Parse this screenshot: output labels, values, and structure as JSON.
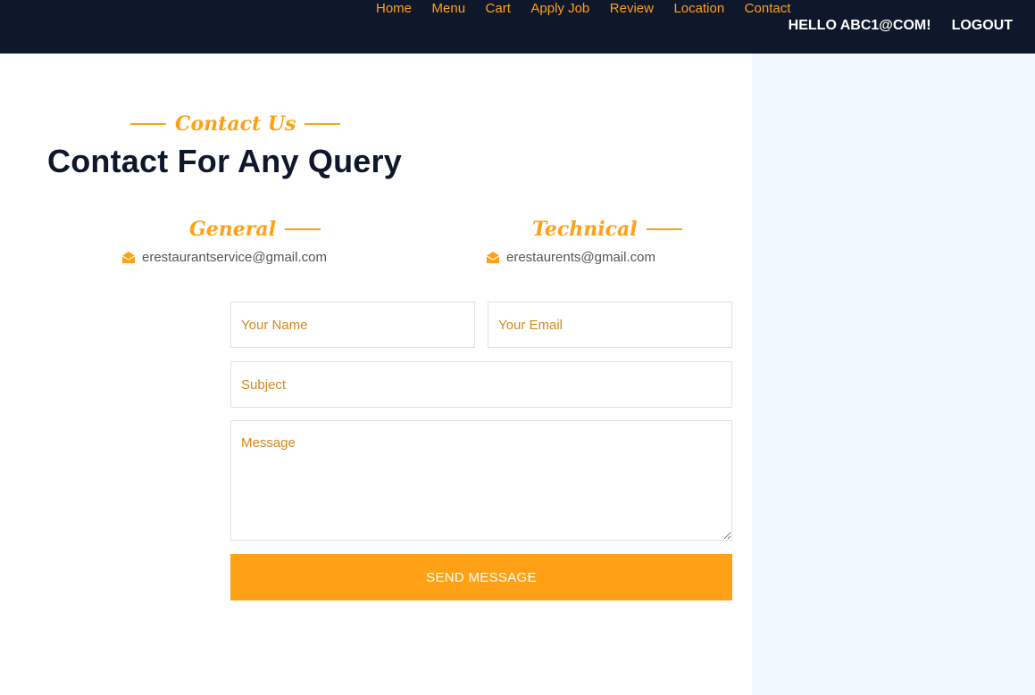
{
  "nav": {
    "links": [
      "Home",
      "Menu",
      "Cart",
      "Apply Job",
      "Review",
      "Location",
      "Contact"
    ],
    "greeting": "HELLO ABC1@COM!",
    "logout_label": "LOGOUT",
    "accent_color": "#fea116",
    "bg_color": "#0f172b"
  },
  "header": {
    "subtitle": "Contact Us",
    "title": "Contact For Any Query"
  },
  "contacts": {
    "general": {
      "label": "General",
      "email": "erestaurantservice@gmail.com",
      "icon": "envelope-open-icon"
    },
    "technical": {
      "label": "Technical",
      "email": "erestaurents@gmail.com",
      "icon": "envelope-open-icon"
    }
  },
  "form": {
    "name_placeholder": "Your Name",
    "email_placeholder": "Your Email",
    "subject_placeholder": "Subject",
    "message_placeholder": "Message",
    "submit_label": "SEND MESSAGE"
  }
}
